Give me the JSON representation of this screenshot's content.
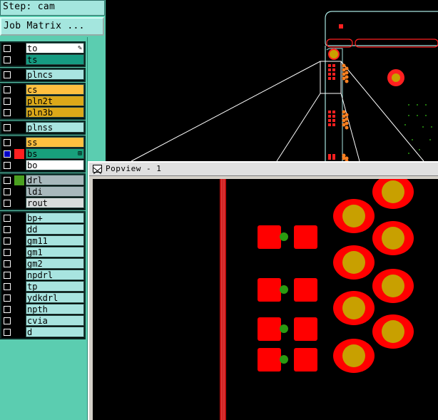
{
  "step": {
    "label": "Step: cam"
  },
  "job_matrix_button": "Job Matrix ...",
  "layer_groups": [
    [
      {
        "name": "to",
        "color": "white",
        "swatch": "",
        "checked": false,
        "marker": "✎"
      },
      {
        "name": "ts",
        "color": "teal",
        "swatch": "",
        "checked": false
      }
    ],
    [
      {
        "name": "plncs",
        "color": "aqua",
        "swatch": "",
        "checked": false
      }
    ],
    [
      {
        "name": "cs",
        "color": "orange",
        "swatch": "",
        "checked": false
      },
      {
        "name": "pln2t",
        "color": "gold",
        "swatch": "",
        "checked": false
      },
      {
        "name": "pln3b",
        "color": "gold",
        "swatch": "",
        "checked": false
      }
    ],
    [
      {
        "name": "plnss",
        "color": "aqua",
        "swatch": "",
        "checked": false
      }
    ],
    [
      {
        "name": "ss",
        "color": "orange",
        "swatch": "",
        "checked": false
      },
      {
        "name": "bs",
        "color": "green",
        "swatch": "#ff2020",
        "checked": true,
        "marker": "⊞"
      },
      {
        "name": "bo",
        "color": "white",
        "swatch": "",
        "checked": false
      }
    ],
    [
      {
        "name": "drl",
        "color": "gray",
        "swatch": "#4aa020",
        "checked": false
      },
      {
        "name": "ldi",
        "color": "gray",
        "swatch": "",
        "checked": false
      },
      {
        "name": "rout",
        "color": "lgray",
        "swatch": "",
        "checked": false
      }
    ],
    [
      {
        "name": "bp+",
        "color": "aqua",
        "swatch": "",
        "checked": false
      },
      {
        "name": "dd",
        "color": "aqua",
        "swatch": "",
        "checked": false
      },
      {
        "name": "gm11",
        "color": "aqua",
        "swatch": "",
        "checked": false
      },
      {
        "name": "gm1",
        "color": "aqua",
        "swatch": "",
        "checked": false
      },
      {
        "name": "gm2",
        "color": "aqua",
        "swatch": "",
        "checked": false
      },
      {
        "name": "npdrl",
        "color": "aqua",
        "swatch": "",
        "checked": false
      },
      {
        "name": "tp",
        "color": "aqua",
        "swatch": "",
        "checked": false
      },
      {
        "name": "ydkdrl",
        "color": "aqua",
        "swatch": "",
        "checked": false
      },
      {
        "name": "npth",
        "color": "aqua",
        "swatch": "",
        "checked": false
      },
      {
        "name": "cvia",
        "color": "aqua",
        "swatch": "",
        "checked": false
      },
      {
        "name": "d",
        "color": "aqua",
        "swatch": "",
        "checked": false
      }
    ]
  ],
  "popview": {
    "title": "Popview - 1",
    "icon": "close-x-icon"
  },
  "colors": {
    "pad_red": "#ff0000",
    "drill_gold": "#c8a000",
    "via_green": "#2a9a10",
    "outline_cyan": "#a8e4e0",
    "trace_red": "#c01010"
  }
}
